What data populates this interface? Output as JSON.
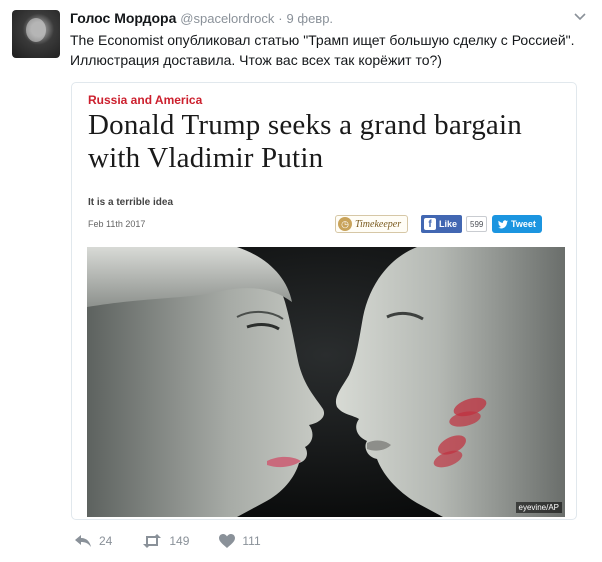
{
  "tweet": {
    "author_name": "Голос Мордора",
    "author_handle": "@spacelordrock",
    "separator": "·",
    "time": "9 февр.",
    "text": "The Economist опубликовал статью \"Трамп ищет большую сделку с Россией\". Иллюстрация доставила. Чтож вас всех так корёжит то?)"
  },
  "card": {
    "kicker": "Russia and America",
    "headline": "Donald Trump seeks a grand bargain with Vladimir Putin",
    "subhead": "It is a terrible idea",
    "date": "Feb 11th 2017",
    "timekeeper_label": "Timekeeper",
    "fb_like_label": "Like",
    "fb_like_count": "599",
    "tweet_button_label": "Tweet",
    "photo_credit": "eyevine/AP"
  },
  "actions": {
    "replies": "24",
    "retweets": "149",
    "likes": "111"
  },
  "colors": {
    "kicker_red": "#cc1f2d",
    "facebook_blue": "#4267b2",
    "twitter_blue": "#1b95e0",
    "muted_gray": "#8a9199"
  },
  "icons": [
    "more-caret-icon",
    "timekeeper-icon",
    "facebook-icon",
    "twitter-bird-icon",
    "reply-icon",
    "retweet-icon",
    "heart-icon"
  ]
}
